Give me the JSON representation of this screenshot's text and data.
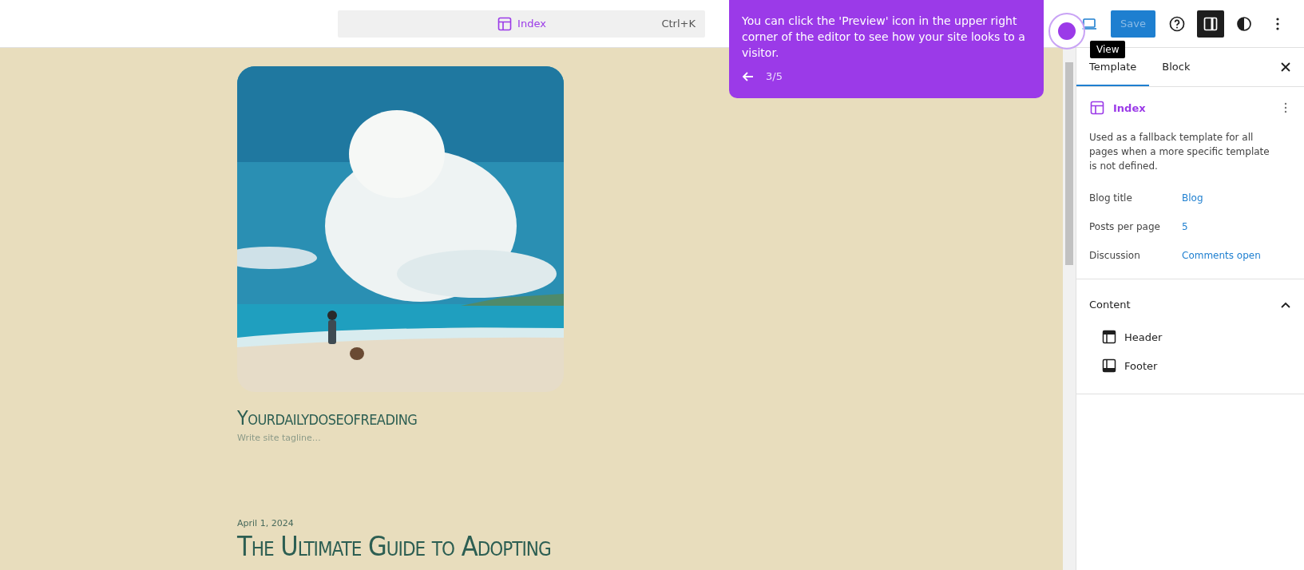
{
  "command_bar": {
    "label": "Index",
    "shortcut": "Ctrl+K"
  },
  "tour": {
    "message": "You can click the 'Preview' icon in the upper right corner of the editor to see how your site looks to a visitor.",
    "step": "3/5"
  },
  "toolbar": {
    "tooltip": "View",
    "save": {
      "label": "Save",
      "disabled": true
    },
    "sidebar_toggle": {
      "on": true
    }
  },
  "canvas": {
    "site_title": "Yourdailydoseofreading",
    "tagline": "Write site tagline…",
    "post": {
      "date": "April 1, 2024",
      "title": "The Ultimate Guide to Adopting"
    }
  },
  "sidebar": {
    "tabs": [
      {
        "label": "Template",
        "selected": true
      },
      {
        "label": "Block",
        "selected": false
      }
    ],
    "template": {
      "name": "Index",
      "description": "Used as a fallback template for all pages when a more specific template is not defined."
    },
    "properties": [
      {
        "label": "Blog title",
        "value": "Blog"
      },
      {
        "label": "Posts per page",
        "value": "5"
      },
      {
        "label": "Discussion",
        "value": "Comments open"
      }
    ],
    "content": {
      "title": "Content",
      "expanded": true,
      "items": [
        {
          "label": "Header",
          "kind": "header"
        },
        {
          "label": "Footer",
          "kind": "footer"
        }
      ]
    }
  }
}
